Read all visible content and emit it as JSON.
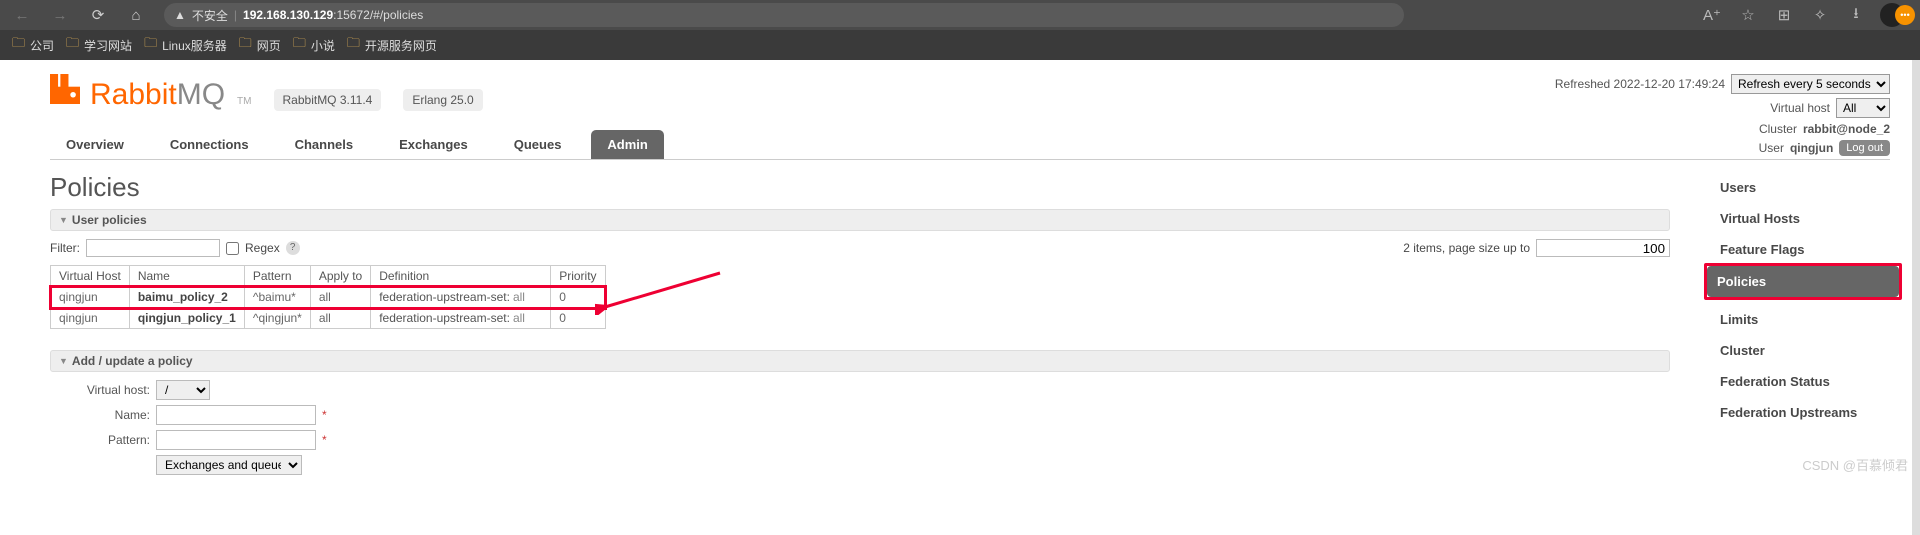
{
  "browser": {
    "insecure_label": "不安全",
    "url_host": "192.168.130.129",
    "url_port": ":15672",
    "url_path": "/#/policies",
    "bookmarks": [
      "公司",
      "学习网站",
      "Linux服务器",
      "网页",
      "小说",
      "开源服务网页"
    ]
  },
  "logo": {
    "tm": "TM"
  },
  "versions": {
    "rabbitmq": "RabbitMQ 3.11.4",
    "erlang": "Erlang 25.0"
  },
  "top_right": {
    "refreshed": "Refreshed 2022-12-20 17:49:24",
    "refresh_select": "Refresh every 5 seconds",
    "vhost_label": "Virtual host",
    "vhost_value": "All",
    "cluster_label": "Cluster",
    "cluster_value": "rabbit@node_2",
    "user_label": "User",
    "user_value": "qingjun",
    "logout": "Log out"
  },
  "tabs": [
    "Overview",
    "Connections",
    "Channels",
    "Exchanges",
    "Queues",
    "Admin"
  ],
  "active_tab": "Admin",
  "page_title": "Policies",
  "sections": {
    "user_policies": "User policies",
    "add_update": "Add / update a policy"
  },
  "filter": {
    "label": "Filter:",
    "regex": "Regex"
  },
  "paging": {
    "text": "2 items, page size up to",
    "value": "100"
  },
  "table": {
    "headers": [
      "Virtual Host",
      "Name",
      "Pattern",
      "Apply to",
      "Definition",
      "Priority"
    ],
    "rows": [
      {
        "vhost": "qingjun",
        "name": "baimu_policy_2",
        "pattern": "^baimu*",
        "apply": "all",
        "def_key": "federation-upstream-set:",
        "def_val": "all",
        "priority": "0",
        "highlight": true
      },
      {
        "vhost": "qingjun",
        "name": "qingjun_policy_1",
        "pattern": "^qingjun*",
        "apply": "all",
        "def_key": "federation-upstream-set:",
        "def_val": "all",
        "priority": "0",
        "highlight": false
      }
    ]
  },
  "form": {
    "vhost_lbl": "Virtual host:",
    "vhost_val": "/",
    "name_lbl": "Name:",
    "pattern_lbl": "Pattern:",
    "applyto_placeholder": "Exchanges and queues"
  },
  "right_nav": [
    "Users",
    "Virtual Hosts",
    "Feature Flags",
    "Policies",
    "Limits",
    "Cluster",
    "Federation Status",
    "Federation Upstreams"
  ],
  "right_nav_active": "Policies",
  "watermark": "CSDN @百慕倾君"
}
